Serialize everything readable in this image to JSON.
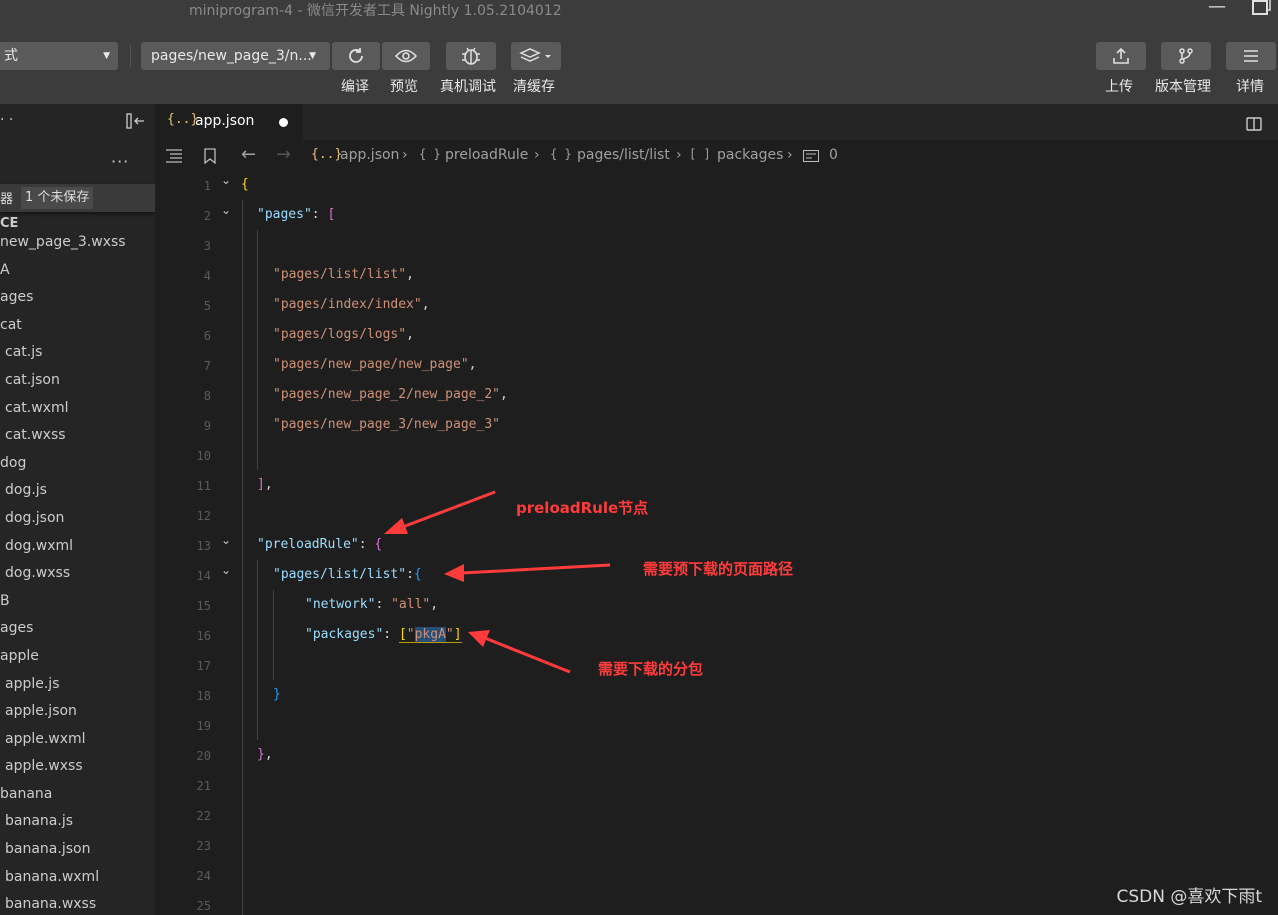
{
  "window": {
    "title": "miniprogram-4 - 微信开发者工具 Nightly 1.05.2104012"
  },
  "toolbar": {
    "mode_select": "式",
    "page_select": "pages/new_page_3/n...",
    "compile_label": "编译",
    "preview_label": "预览",
    "debug_label": "真机调试",
    "cache_label": "清缓存",
    "upload_label": "上传",
    "version_label": "版本管理",
    "detail_label": "详情"
  },
  "sidebar": {
    "header_dots": "· ·",
    "more": "···",
    "editor_label": "器",
    "unsaved": "1 个未保存",
    "section": "CE",
    "tree": [
      "new_page_3.wxss",
      "A",
      "ages",
      "cat",
      "cat.js",
      "cat.json",
      "cat.wxml",
      "cat.wxss",
      "dog",
      "dog.js",
      "dog.json",
      "dog.wxml",
      "dog.wxss",
      "B",
      "ages",
      "apple",
      "apple.js",
      "apple.json",
      "apple.wxml",
      "apple.wxss",
      "banana",
      "banana.js",
      "banana.json",
      "banana.wxml",
      "banana.wxss"
    ]
  },
  "tab": {
    "icon": "{..}",
    "label": "app.json"
  },
  "breadcrumb": {
    "icon": "{..}",
    "file": "app.json",
    "seg1": "preloadRule",
    "seg2": "pages/list/list",
    "seg3": "packages",
    "seg4": "0",
    "obj_icon": "{ }",
    "arr_icon": "[ ]"
  },
  "code": {
    "line_numbers": [
      "1",
      "2",
      "3",
      "4",
      "5",
      "6",
      "7",
      "8",
      "9",
      "10",
      "11",
      "12",
      "13",
      "14",
      "15",
      "16",
      "17",
      "18",
      "19",
      "20",
      "21",
      "22",
      "23",
      "24",
      "25"
    ],
    "l1": "{",
    "l2_key": "\"pages\"",
    "l2_rest": ": ",
    "l2_br": "[",
    "l4": "\"pages/list/list\"",
    "l5": "\"pages/index/index\"",
    "l6": "\"pages/logs/logs\"",
    "l7": "\"pages/new_page/new_page\"",
    "l8": "\"pages/new_page_2/new_page_2\"",
    "l9": "\"pages/new_page_3/new_page_3\"",
    "comma": ",",
    "l11": "]",
    "l13_key": "\"preloadRule\"",
    "l13_colon": ": ",
    "l13_br": "{",
    "l14_key": "\"pages/list/list\"",
    "l14_colon": ":",
    "l14_br": "{",
    "l15_key": "\"network\"",
    "l15_colon": ": ",
    "l15_val": "\"all\"",
    "l16_key": "\"packages\"",
    "l16_colon": ": ",
    "l16_open": "[",
    "l16_q1": "\"",
    "l16_val": "pkgA",
    "l16_q2": "\"",
    "l16_close": "]",
    "l18": "}",
    "l20": "}"
  },
  "annotations": {
    "a1": "preloadRule节点",
    "a2": "需要预下载的页面路径",
    "a3": "需要下载的分包"
  },
  "watermark": "CSDN @喜欢下雨t",
  "colors": {
    "annotation": "#ff3b3b",
    "string": "#ce9178",
    "key": "#9cdcfe"
  }
}
